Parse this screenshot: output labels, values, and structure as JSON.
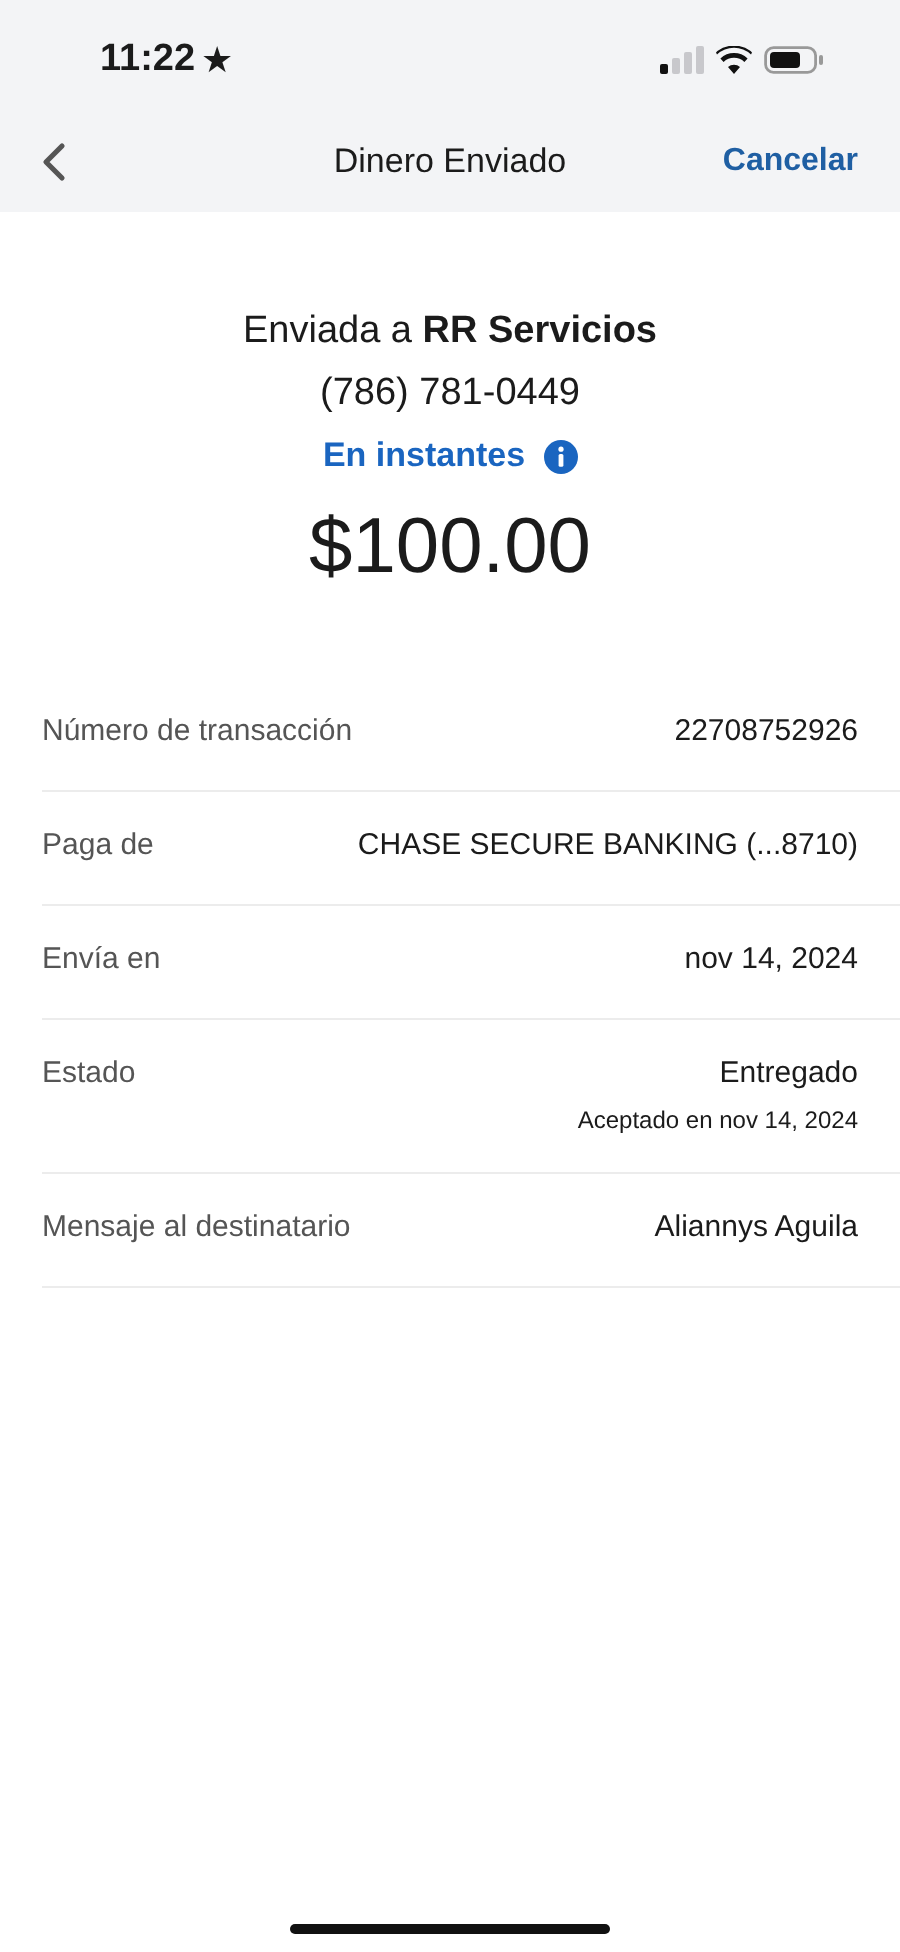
{
  "status_bar": {
    "time": "11:22",
    "star": "★"
  },
  "nav": {
    "title": "Dinero Enviado",
    "action": "Cancelar"
  },
  "summary": {
    "recipient": "Enviada a **RR Servicios**",
    "phone": "(786) 781-0449",
    "speed": "En instantes",
    "amount": "$100.00"
  },
  "details": [
    {
      "label": "Número de transacción",
      "value": "22708752926"
    },
    {
      "label": "Paga de",
      "value": "CHASE SECURE BANKING (...8710)"
    },
    {
      "label": "Envía en",
      "value": "nov 14, 2024"
    },
    {
      "label": "Estado",
      "value": "Entregado",
      "note": "Aceptado en nov 14, 2024"
    },
    {
      "label": "Mensaje al destinatario",
      "value": "Aliannys Aguila"
    }
  ]
}
